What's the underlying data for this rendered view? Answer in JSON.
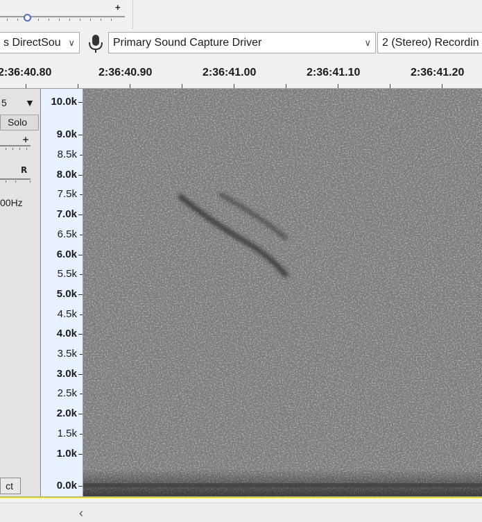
{
  "toolbar": {
    "gain_plus": "+",
    "gain_level": 0.2
  },
  "devices": {
    "host": "s DirectSou",
    "recording": "Primary Sound Capture Driver",
    "channels": "2 (Stereo) Recordin",
    "dropdown_arrow": "∨",
    "mic_icon": "microphone-icon"
  },
  "ruler": {
    "labels": [
      "2:36:40.80",
      "2:36:40.90",
      "2:36:41.00",
      "2:36:41.10",
      "2:36:41.20"
    ]
  },
  "track": {
    "menu_label": "5",
    "menu_arrow": "▼",
    "solo_label": "Solo",
    "gain_plus": "+",
    "pan_right": "R",
    "rate": "00Hz",
    "select_label": "ct"
  },
  "freq_axis": {
    "labels": [
      {
        "text": "10.0k",
        "major": true
      },
      {
        "text": "9.0k",
        "major": true
      },
      {
        "text": "8.5k",
        "major": false
      },
      {
        "text": "8.0k",
        "major": true
      },
      {
        "text": "7.5k",
        "major": false
      },
      {
        "text": "7.0k",
        "major": true
      },
      {
        "text": "6.5k",
        "major": false
      },
      {
        "text": "6.0k",
        "major": true
      },
      {
        "text": "5.5k",
        "major": false
      },
      {
        "text": "5.0k",
        "major": true
      },
      {
        "text": "4.5k",
        "major": false
      },
      {
        "text": "4.0k",
        "major": true
      },
      {
        "text": "3.5k",
        "major": false
      },
      {
        "text": "3.0k",
        "major": true
      },
      {
        "text": "2.5k",
        "major": false
      },
      {
        "text": "2.0k",
        "major": true
      },
      {
        "text": "1.5k",
        "major": false
      },
      {
        "text": "1.0k",
        "major": true
      },
      {
        "text": "0.0k",
        "major": true
      }
    ]
  },
  "scrollbar": {
    "left_arrow": "‹"
  },
  "colors": {
    "spectro_bg": "#7d7d7d",
    "axis_bg": "#e8f1ff",
    "track_border": "#d8c400",
    "slider_thumb": "#4a6cd4"
  }
}
